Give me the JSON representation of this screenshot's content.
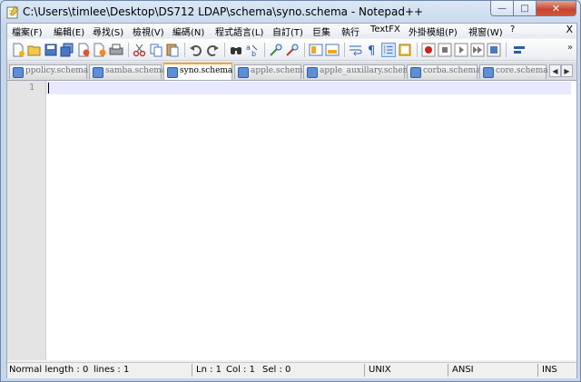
{
  "window": {
    "title": "C:\\Users\\timlee\\Desktop\\DS712 LDAP\\schema\\syno.schema - Notepad++",
    "min_glyph": "—",
    "max_glyph": "□",
    "close_glyph": "✕"
  },
  "menu": {
    "items": [
      "檔案(F)",
      "編輯(E)",
      "尋找(S)",
      "檢視(V)",
      "編碼(N)",
      "程式語言(L)",
      "自訂(T)",
      "巨集",
      "執行",
      "TextFX",
      "外掛模組(P)",
      "視窗(W)",
      "?"
    ],
    "close_glyph": "X"
  },
  "toolbar": {
    "overflow_glyph": "»"
  },
  "tabs": {
    "items": [
      "ppolicy.schema",
      "samba.schema",
      "syno.schema",
      "apple.schema",
      "apple_auxillary.schema",
      "corba.schema",
      "core.schema"
    ],
    "active_index": 2,
    "scroll_left": "◀",
    "scroll_right": "▶"
  },
  "editor": {
    "line_numbers": [
      "1"
    ],
    "content": ""
  },
  "status": {
    "length": "Normal length : 0",
    "lines": "lines : 1",
    "ln": "Ln : 1",
    "col": "Col : 1",
    "sel": "Sel : 0",
    "eol": "UNIX",
    "encoding": "ANSI",
    "mode": "INS"
  },
  "colors": {
    "active_tab_accent": "#f5a623",
    "current_line": "#e8e8ff",
    "close_button": "#c7442d"
  }
}
